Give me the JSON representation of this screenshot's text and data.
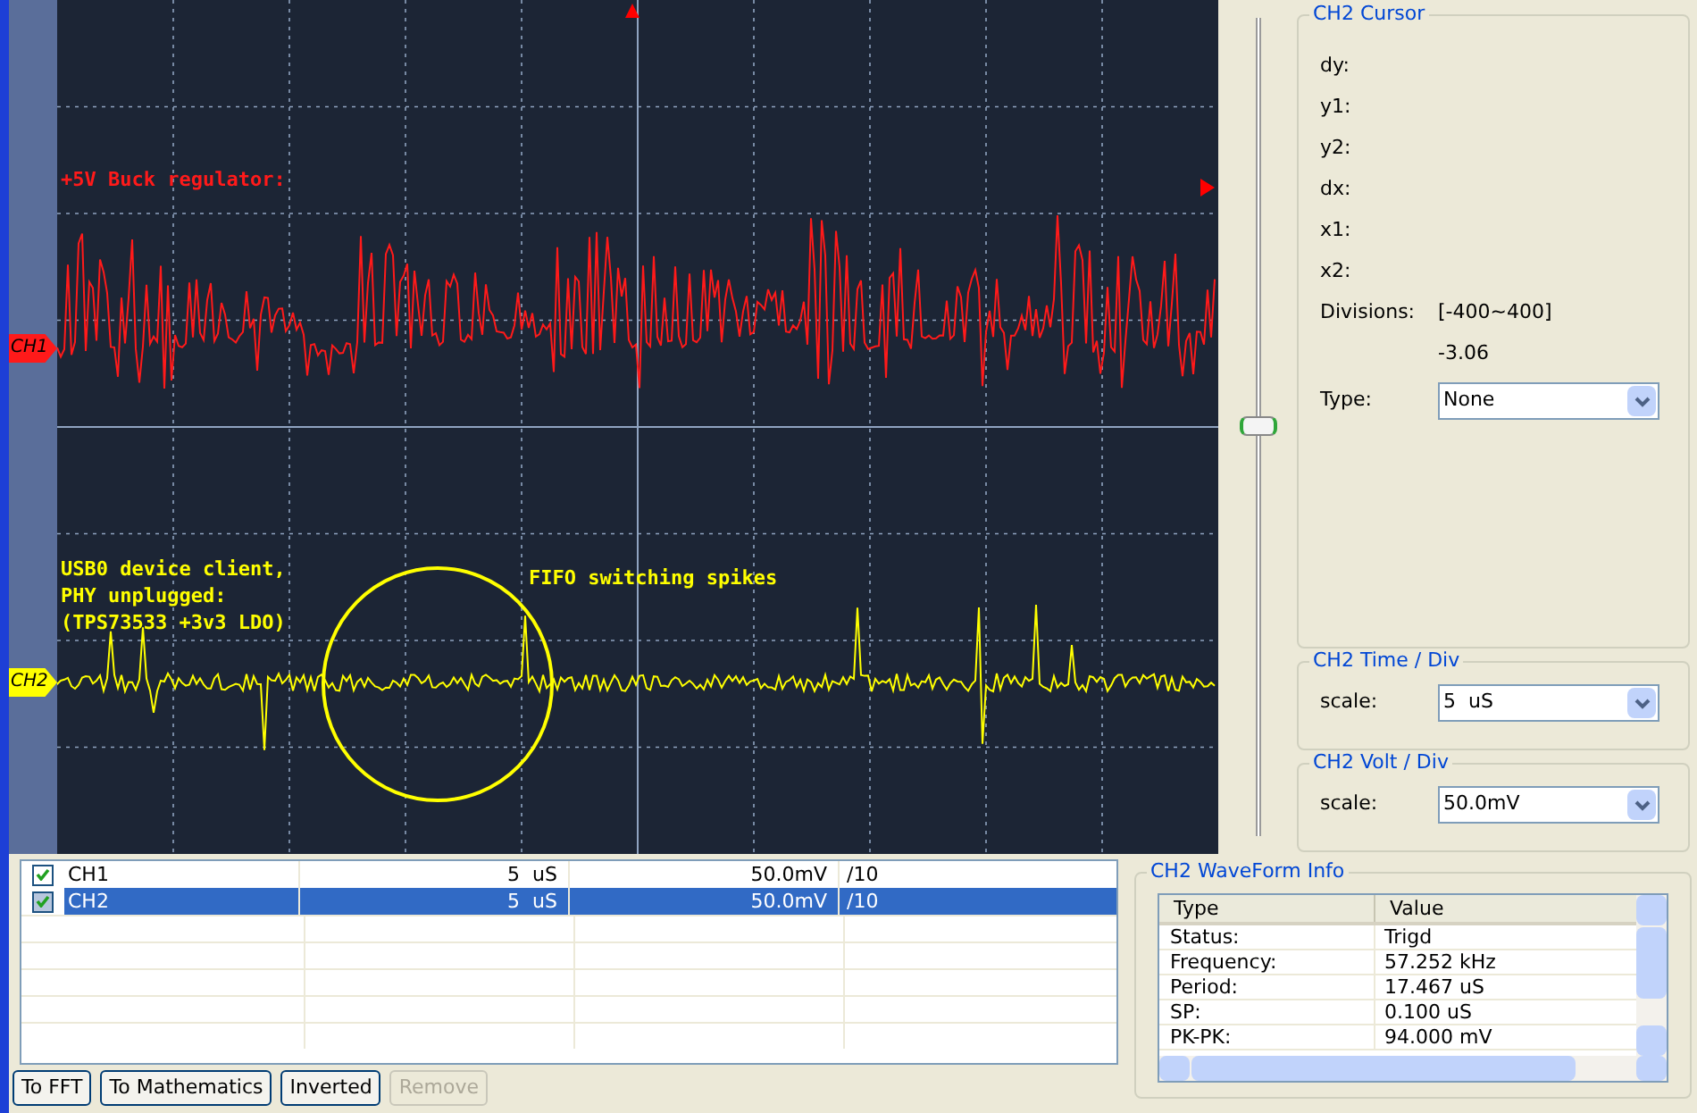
{
  "scope": {
    "traces": [
      {
        "label": "CH1",
        "color": "#ff1a1a",
        "annotations": [
          "+5V Buck regulator:"
        ]
      },
      {
        "label": "CH2",
        "color": "#ffff00",
        "annotations": [
          "USB0 device client,",
          "PHY unplugged:",
          "(TPS73533 +3v3 LDO)"
        ],
        "note": "FIFO switching spikes"
      }
    ]
  },
  "offset_slider": {
    "level": 0.5
  },
  "cursor_panel": {
    "title": "CH2 Cursor",
    "fields": [
      "dy:",
      "y1:",
      "y2:",
      "dx:",
      "x1:",
      "x2:"
    ],
    "divisions": {
      "label": "Divisions:",
      "range": "[-400~400]",
      "value": "-3.06"
    },
    "type": {
      "label": "Type:",
      "value": "None"
    }
  },
  "time_div": {
    "title": "CH2 Time / Div",
    "label": "scale:",
    "value": "5  uS"
  },
  "volt_div": {
    "title": "CH2 Volt / Div",
    "label": "scale:",
    "value": "50.0mV"
  },
  "channels": [
    {
      "name": "CH1",
      "checked": true,
      "selected": false,
      "time": "5  uS",
      "volt": "50.0mV",
      "probe": "/10"
    },
    {
      "name": "CH2",
      "checked": true,
      "selected": true,
      "time": "5  uS",
      "volt": "50.0mV",
      "probe": "/10"
    }
  ],
  "buttons": [
    {
      "label": "To FFT",
      "disabled": false
    },
    {
      "label": "To Mathematics",
      "disabled": false
    },
    {
      "label": "Inverted",
      "disabled": false
    },
    {
      "label": "Remove",
      "disabled": true
    }
  ],
  "waveform_info": {
    "title": "CH2 WaveForm Info",
    "columns": [
      "Type",
      "Value"
    ],
    "rows": [
      {
        "type": "Status:",
        "value": "Trigd"
      },
      {
        "type": "Frequency:",
        "value": "57.252 kHz"
      },
      {
        "type": "Period:",
        "value": "17.467 uS"
      },
      {
        "type": "SP:",
        "value": "0.100 uS"
      },
      {
        "type": "PK-PK:",
        "value": "94.000 mV"
      }
    ]
  }
}
